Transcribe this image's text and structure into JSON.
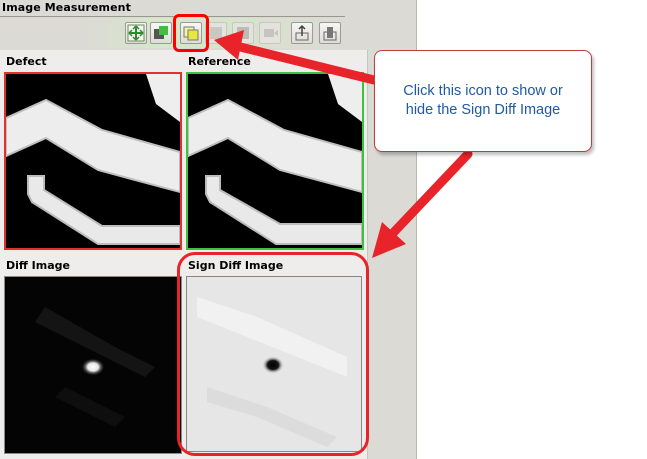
{
  "panel": {
    "title": "Image Measurement"
  },
  "toolbar": {
    "buttons": [
      {
        "icon": "fit-view-icon",
        "enabled": true
      },
      {
        "icon": "overlay-icon",
        "enabled": true
      },
      {
        "icon": "sign-diff-toggle-icon",
        "enabled": true,
        "highlighted": true
      },
      {
        "icon": "disabled-tool-icon-1",
        "enabled": false
      },
      {
        "icon": "disabled-tool-icon-2",
        "enabled": false
      },
      {
        "icon": "disabled-tool-icon-3",
        "enabled": false
      },
      {
        "icon": "export-up-icon",
        "enabled": true
      },
      {
        "icon": "export-chart-icon",
        "enabled": true
      }
    ]
  },
  "images": {
    "defect_label": "Defect",
    "reference_label": "Reference",
    "diff_label": "Diff Image",
    "sign_diff_label": "Sign Diff Image"
  },
  "annotation": {
    "callout_text": "Click this icon to show or hide the Sign Diff Image",
    "highlight_color": "#e8242a",
    "text_color": "#1f5aa8"
  },
  "colors": {
    "defect_border": "#e03030",
    "reference_border": "#40c040"
  }
}
